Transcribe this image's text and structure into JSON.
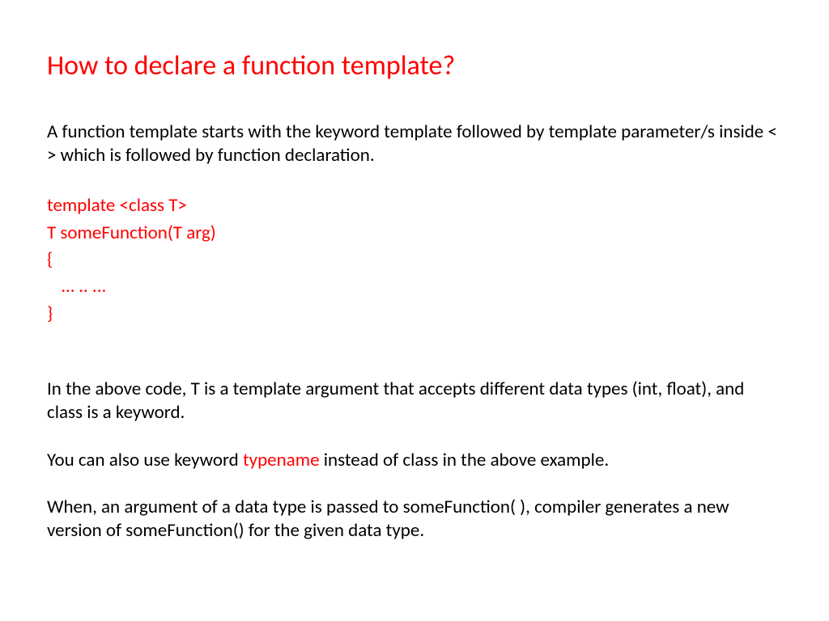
{
  "title": "How to declare a function template?",
  "intro": "A function template starts with the keyword template followed by template parameter/s inside  < > which is followed by function declaration.",
  "code": {
    "line1": "template <class T>",
    "line2": "T someFunction(T arg)",
    "line3": "{",
    "line4": "… .. ...",
    "line5": "}"
  },
  "para2": "In the above code, T is a template argument that accepts different data types (int, float), and class is a keyword.",
  "para3_a": "You can also use keyword ",
  "para3_keyword": "typename",
  "para3_b": " instead of class in the above example.",
  "para4": "When, an argument of a data type is passed to someFunction( ), compiler generates a new version of someFunction() for the given data type."
}
